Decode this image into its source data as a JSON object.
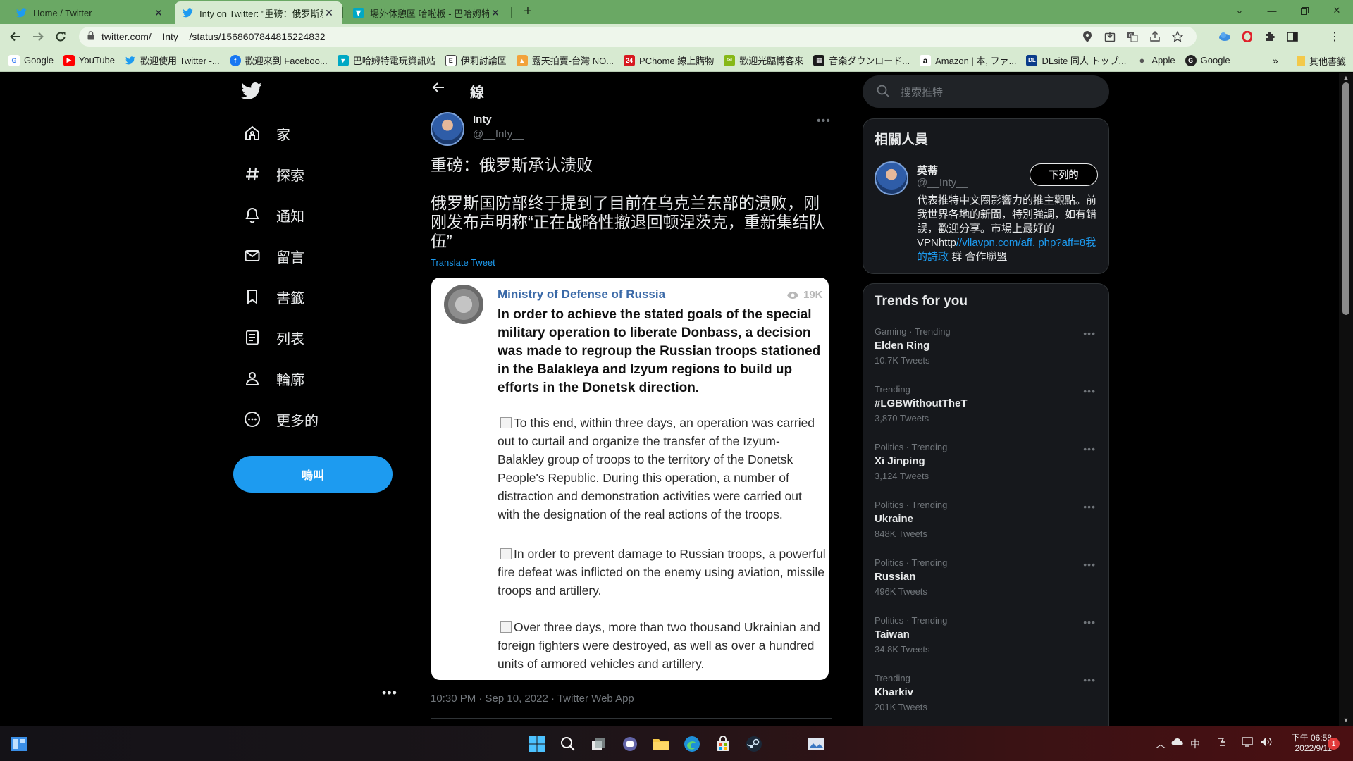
{
  "browser": {
    "tabs": [
      {
        "title": "Home / Twitter",
        "active": false
      },
      {
        "title": "Inty on Twitter: \"重磅：俄罗斯承",
        "active": true
      },
      {
        "title": "場外休憩區 哈啦板 - 巴哈姆特",
        "active": false
      }
    ],
    "url": "twitter.com/__Inty__/status/1568607844815224832",
    "bookmarks": [
      {
        "label": "Google",
        "icon": "google-icon"
      },
      {
        "label": "YouTube",
        "icon": "youtube-icon"
      },
      {
        "label": "歡迎使用 Twitter -...",
        "icon": "twitter-icon"
      },
      {
        "label": "歡迎來到 Faceboo...",
        "icon": "facebook-icon"
      },
      {
        "label": "巴哈姆特電玩資訊站",
        "icon": "bahamut-icon"
      },
      {
        "label": "伊莉討論區",
        "icon": "eyny-icon"
      },
      {
        "label": "露天拍賣-台灣 NO...",
        "icon": "ruten-icon"
      },
      {
        "label": "PChome 線上購物",
        "icon": "pchome-icon"
      },
      {
        "label": "歡迎光臨博客來",
        "icon": "books-icon"
      },
      {
        "label": "音楽ダウンロード...",
        "icon": "music-icon"
      },
      {
        "label": "Amazon | 本, ファ...",
        "icon": "amazon-icon"
      },
      {
        "label": "DLsite 同人 トップ...",
        "icon": "dlsite-icon"
      },
      {
        "label": "Apple",
        "icon": "apple-icon"
      },
      {
        "label": "Google",
        "icon": "google-alt-icon"
      }
    ],
    "bookmarks_more": "»",
    "other_bookmarks": "其他書籤"
  },
  "nav": {
    "items": [
      {
        "label": "家",
        "icon": "home-icon"
      },
      {
        "label": "探索",
        "icon": "hashtag-icon"
      },
      {
        "label": "通知",
        "icon": "bell-icon"
      },
      {
        "label": "留言",
        "icon": "envelope-icon"
      },
      {
        "label": "書籤",
        "icon": "bookmark-icon"
      },
      {
        "label": "列表",
        "icon": "list-icon"
      },
      {
        "label": "輪廓",
        "icon": "profile-icon"
      },
      {
        "label": "更多的",
        "icon": "more-circle-icon"
      }
    ],
    "tweet_button": "鳴叫",
    "account_dots": "•••"
  },
  "tweet": {
    "header_title": "線",
    "author_name": "Inty",
    "author_handle": "@__Inty__",
    "text_line1": "重磅：俄罗斯承认溃败",
    "text_line2": "俄罗斯国防部终于提到了目前在乌克兰东部的溃败，刚刚发布声明称“正在战略性撤退回顿涅茨克，重新集结队伍”",
    "translate": "Translate Tweet",
    "timestamp": "10:30 PM · Sep 10, 2022 · Twitter Web App",
    "card": {
      "name": "Ministry of Defense of Russia",
      "views": "19K",
      "lead": "In order to achieve the stated goals of the special military operation to liberate Donbass, a decision was made to regroup the Russian troops stationed in the Balakleya and Izyum regions to build up efforts in the Donetsk direction.",
      "para1": "To this end, within three days, an operation was carried out to curtail and organize the transfer of the Izyum-Balakley group of troops to the territory of the Donetsk People's Republic. During this operation, a number of distraction and demonstration activities were carried out with the designation of the real actions of the troops.",
      "para2": "In order to prevent damage to Russian troops, a powerful fire defeat was inflicted on the enemy using aviation, missile troops and artillery.",
      "para3": "Over three days, more than two thousand Ukrainian and foreign fighters were destroyed, as well as over a hundred units of armored vehicles and artillery."
    }
  },
  "right": {
    "search_placeholder": "搜索推特",
    "people_title": "相關人員",
    "person_name": "英蒂",
    "person_handle": "@__Inty__",
    "follow_label": "下列的",
    "bio_text": "代表推特中文圈影響力的推主觀點。前我世界各地的新聞，特別強調，如有錯誤，歡迎分享。市場上最好的VPNhttp",
    "bio_link": "//vllavpn.com/aff. php?aff=8我的詩政",
    "bio_tail": "群 合作聯盟",
    "trends_title": "Trends for you",
    "trends": [
      {
        "meta": "Gaming · Trending",
        "name": "Elden Ring",
        "count": "10.7K Tweets"
      },
      {
        "meta": "Trending",
        "name": "#LGBWithoutTheT",
        "count": "3,870 Tweets"
      },
      {
        "meta": "Politics · Trending",
        "name": "Xi Jinping",
        "count": "3,124 Tweets"
      },
      {
        "meta": "Politics · Trending",
        "name": "Ukraine",
        "count": "848K Tweets"
      },
      {
        "meta": "Politics · Trending",
        "name": "Russian",
        "count": "496K Tweets"
      },
      {
        "meta": "Politics · Trending",
        "name": "Taiwan",
        "count": "34.8K Tweets"
      },
      {
        "meta": "Trending",
        "name": "Kharkiv",
        "count": "201K Tweets"
      }
    ]
  },
  "taskbar": {
    "ime": "中",
    "clock_line1": "下午 06:58",
    "clock_line2": "2022/9/11",
    "notification_count": "1"
  }
}
